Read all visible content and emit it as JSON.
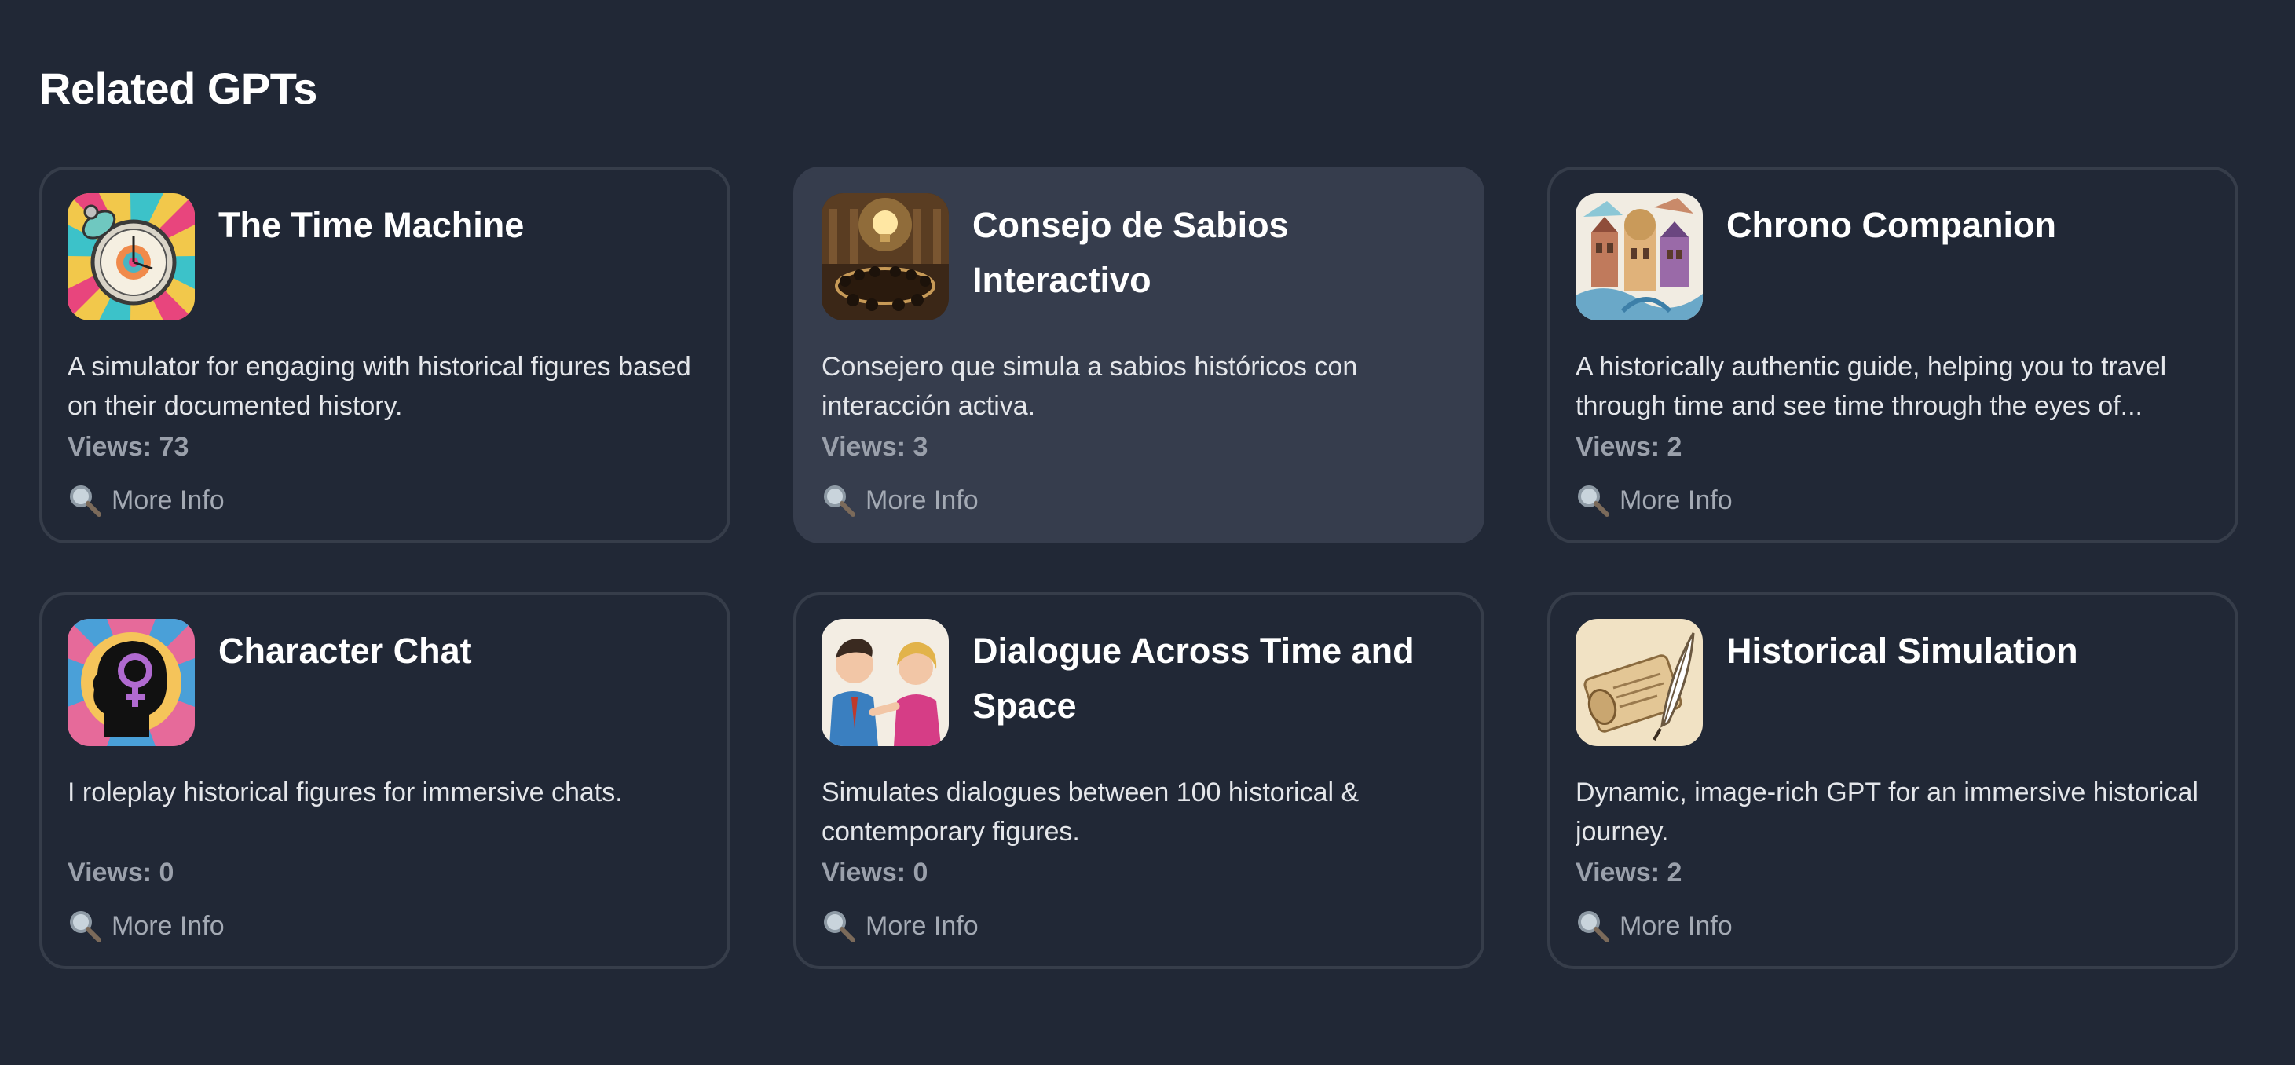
{
  "section": {
    "title": "Related GPTs"
  },
  "cards": [
    {
      "title": "The Time Machine",
      "description": "A simulator for engaging with historical figures based on their documented history.",
      "views": "Views: 73",
      "link": "More Info",
      "icon": "pocket-watch-icon"
    },
    {
      "title": "Consejo de Sabios Interactivo",
      "description": "Consejero que simula a sabios históricos con interacción activa.",
      "views": "Views: 3",
      "link": "More Info",
      "icon": "council-lightbulb-icon"
    },
    {
      "title": "Chrono Companion",
      "description": "A historically authentic guide, helping you to travel through time and see time through the eyes of...",
      "views": "Views: 2",
      "link": "More Info",
      "icon": "historic-city-icon"
    },
    {
      "title": "Character Chat",
      "description": "I roleplay historical figures for immersive chats.",
      "views": "Views: 0",
      "link": "More Info",
      "icon": "head-silhouette-icon"
    },
    {
      "title": "Dialogue Across Time and Space",
      "description": "Simulates dialogues between 100 historical & contemporary figures.",
      "views": "Views: 0",
      "link": "More Info",
      "icon": "pop-art-couple-icon"
    },
    {
      "title": "Historical Simulation",
      "description": "Dynamic, image-rich GPT for an immersive historical journey.",
      "views": "Views: 2",
      "link": "More Info",
      "icon": "scroll-quill-icon"
    }
  ],
  "colors": {
    "background": "#212836",
    "card_border": "#363d4a",
    "card_hover": "#363d4d",
    "views_text": "#9aa0ab",
    "link_text": "#a4aab4"
  },
  "link_icon": "magnifying-glass-icon"
}
